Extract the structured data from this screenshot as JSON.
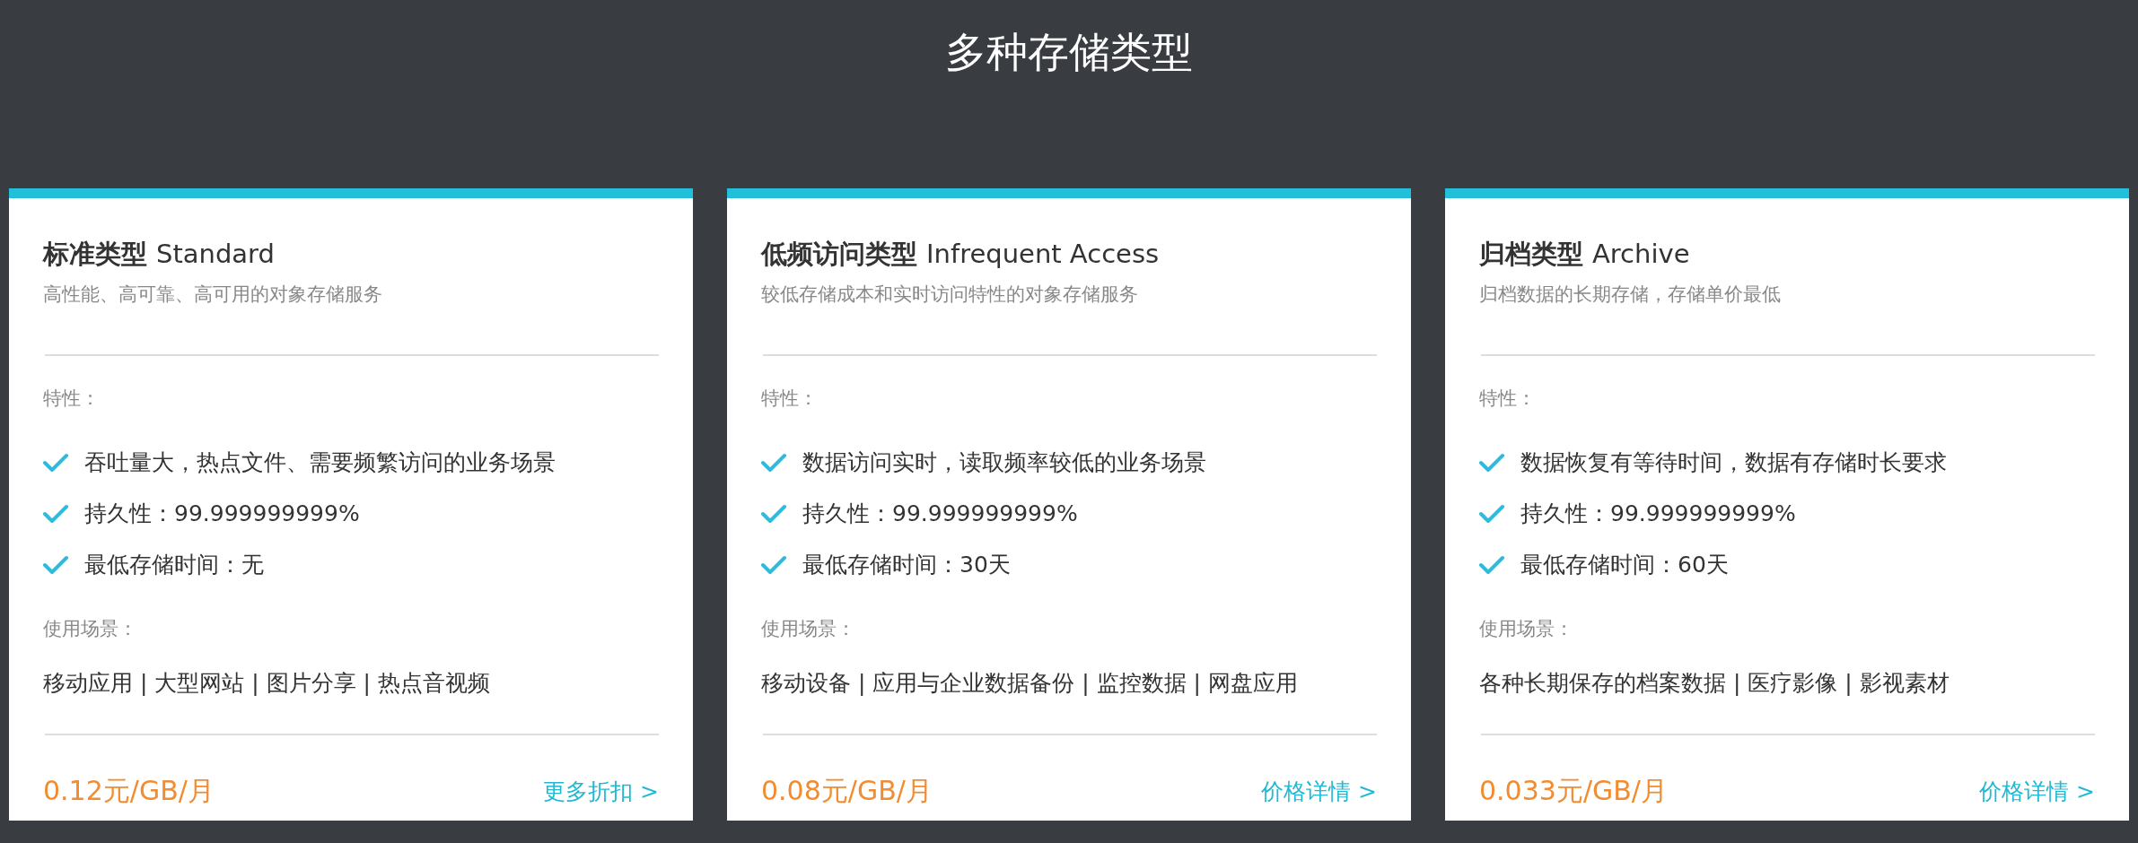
{
  "title": "多种存储类型",
  "cards": [
    {
      "name_cn": "标准类型",
      "name_en": "Standard",
      "subtitle": "高性能、高可靠、高可用的对象存储服务",
      "features_label": "特性：",
      "features": [
        "吞吐量大，热点文件、需要频繁访问的业务场景",
        "持久性：99.999999999%",
        "最低存储时间：无"
      ],
      "scenarios_label": "使用场景：",
      "scenarios": "移动应用 | 大型网站 | 图片分享 | 热点音视频",
      "price": "0.12元/GB/月",
      "link": "更多折扣 >"
    },
    {
      "name_cn": "低频访问类型",
      "name_en": "Infrequent Access",
      "subtitle": "较低存储成本和实时访问特性的对象存储服务",
      "features_label": "特性：",
      "features": [
        "数据访问实时，读取频率较低的业务场景",
        "持久性：99.999999999%",
        "最低存储时间：30天"
      ],
      "scenarios_label": "使用场景：",
      "scenarios": "移动设备 | 应用与企业数据备份 | 监控数据 | 网盘应用",
      "price": "0.08元/GB/月",
      "link": "价格详情 >"
    },
    {
      "name_cn": "归档类型",
      "name_en": "Archive",
      "subtitle": "归档数据的长期存储，存储单价最低",
      "features_label": "特性：",
      "features": [
        "数据恢复有等待时间，数据有存储时长要求",
        "持久性：99.999999999%",
        "最低存储时间：60天"
      ],
      "scenarios_label": "使用场景：",
      "scenarios": "各种长期保存的档案数据 | 医疗影像 | 影视素材",
      "price": "0.033元/GB/月",
      "link": "价格详情 >"
    }
  ]
}
